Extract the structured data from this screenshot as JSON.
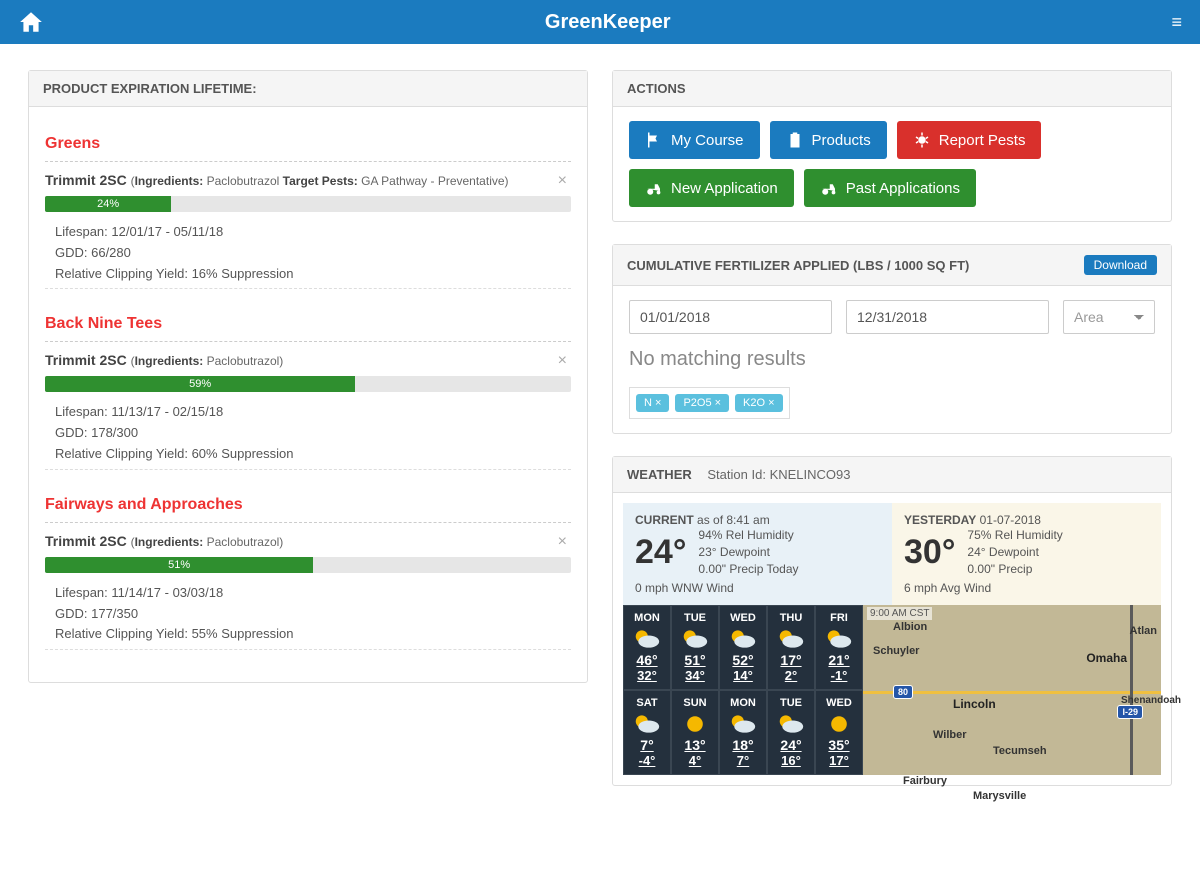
{
  "header": {
    "title": "GreenKeeper"
  },
  "expiration": {
    "title": "PRODUCT EXPIRATION LIFETIME:",
    "sections": [
      {
        "name": "Greens",
        "products": [
          {
            "name": "Trimmit 2SC",
            "ingredients_label": "Ingredients:",
            "ingredients": "Paclobutrazol",
            "pests_label": "Target Pests:",
            "pests": "GA Pathway - Preventative",
            "pct": "24%",
            "pct_w": 24,
            "lifespan_label": "Lifespan:",
            "lifespan": "12/01/17 - 05/11/18",
            "gdd_label": "GDD:",
            "gdd": "66/280",
            "yield_label": "Relative Clipping Yield:",
            "yield": "16% Suppression"
          }
        ]
      },
      {
        "name": "Back Nine Tees",
        "products": [
          {
            "name": "Trimmit 2SC",
            "ingredients_label": "Ingredients:",
            "ingredients": "Paclobutrazol",
            "pct": "59%",
            "pct_w": 59,
            "lifespan_label": "Lifespan:",
            "lifespan": "11/13/17 - 02/15/18",
            "gdd_label": "GDD:",
            "gdd": "178/300",
            "yield_label": "Relative Clipping Yield:",
            "yield": "60% Suppression"
          }
        ]
      },
      {
        "name": "Fairways and Approaches",
        "products": [
          {
            "name": "Trimmit 2SC",
            "ingredients_label": "Ingredients:",
            "ingredients": "Paclobutrazol",
            "pct": "51%",
            "pct_w": 51,
            "lifespan_label": "Lifespan:",
            "lifespan": "11/14/17 - 03/03/18",
            "gdd_label": "GDD:",
            "gdd": "177/350",
            "yield_label": "Relative Clipping Yield:",
            "yield": "55% Suppression"
          }
        ]
      }
    ]
  },
  "actions": {
    "title": "ACTIONS",
    "buttons": {
      "my_course": "My Course",
      "products": "Products",
      "report_pests": "Report Pests",
      "new_app": "New Application",
      "past_apps": "Past Applications"
    }
  },
  "fertilizer": {
    "title": "CUMULATIVE FERTILIZER APPLIED (LBS / 1000 SQ FT)",
    "download": "Download",
    "from": "01/01/2018",
    "to": "12/31/2018",
    "area_placeholder": "Area",
    "no_results": "No matching results",
    "chips": [
      "N ×",
      "P2O5 ×",
      "K2O ×"
    ]
  },
  "weather": {
    "title": "WEATHER",
    "station_label": "Station Id:",
    "station": "KNELINCO93",
    "current": {
      "label": "CURRENT",
      "asof": "as of 8:41 am",
      "temp": "24°",
      "humidity": "94% Rel Humidity",
      "dewpoint": "23° Dewpoint",
      "precip": "0.00\" Precip Today",
      "wind": "0 mph WNW Wind"
    },
    "yesterday": {
      "label": "YESTERDAY",
      "date": "01-07-2018",
      "temp": "30°",
      "humidity": "75% Rel Humidity",
      "dewpoint": "24° Dewpoint",
      "precip": "0.00\" Precip",
      "wind": "6 mph Avg Wind"
    },
    "forecast": [
      {
        "d": "MON",
        "hi": "46°",
        "lo": "32°",
        "ic": "pc"
      },
      {
        "d": "TUE",
        "hi": "51°",
        "lo": "34°",
        "ic": "pc"
      },
      {
        "d": "WED",
        "hi": "52°",
        "lo": "14°",
        "ic": "pc"
      },
      {
        "d": "THU",
        "hi": "17°",
        "lo": "2°",
        "ic": "pc"
      },
      {
        "d": "FRI",
        "hi": "21°",
        "lo": "-1°",
        "ic": "pc"
      },
      {
        "d": "SAT",
        "hi": "7°",
        "lo": "-4°",
        "ic": "pc"
      },
      {
        "d": "SUN",
        "hi": "13°",
        "lo": "4°",
        "ic": "sun"
      },
      {
        "d": "MON",
        "hi": "18°",
        "lo": "7°",
        "ic": "pc"
      },
      {
        "d": "TUE",
        "hi": "24°",
        "lo": "16°",
        "ic": "pc"
      },
      {
        "d": "WED",
        "hi": "35°",
        "lo": "17°",
        "ic": "sun"
      }
    ],
    "map": {
      "time": "9:00 AM CST",
      "cities": [
        "Omaha",
        "Lincoln"
      ],
      "towns": [
        "Albion",
        "Schuyler",
        "Wilber",
        "Tecumseh",
        "Fairbury",
        "Marysville",
        "Atlan",
        "Shenandoah"
      ]
    }
  }
}
